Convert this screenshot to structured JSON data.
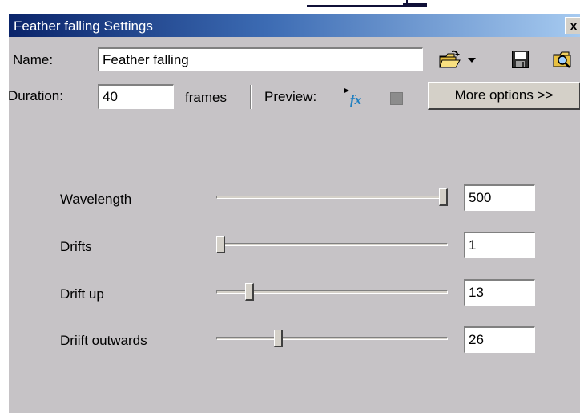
{
  "window": {
    "title": "Feather falling Settings",
    "close_glyph": "x"
  },
  "name_row": {
    "label": "Name:",
    "value": "Feather falling",
    "icons": [
      "open-folder-icon",
      "dropdown-arrow-icon",
      "save-disk-icon",
      "find-icon"
    ]
  },
  "duration_row": {
    "label": "Duration:",
    "value": "40",
    "unit": "frames",
    "preview_label": "Preview:",
    "icons": [
      "play-fx-icon",
      "stop-icon"
    ],
    "more_button": "More options >>"
  },
  "params": [
    {
      "label": "Wavelength",
      "value": "500",
      "level": 1.0
    },
    {
      "label": "Drifts",
      "value": "1",
      "level": 0.0
    },
    {
      "label": "Drift up",
      "value": "13",
      "level": 0.13
    },
    {
      "label": "Driift outwards",
      "value": "26",
      "level": 0.26
    }
  ],
  "colors": {
    "dialog_bg": "#c6c3c6",
    "title_start": "#0a246a",
    "title_end": "#a6caf0"
  }
}
